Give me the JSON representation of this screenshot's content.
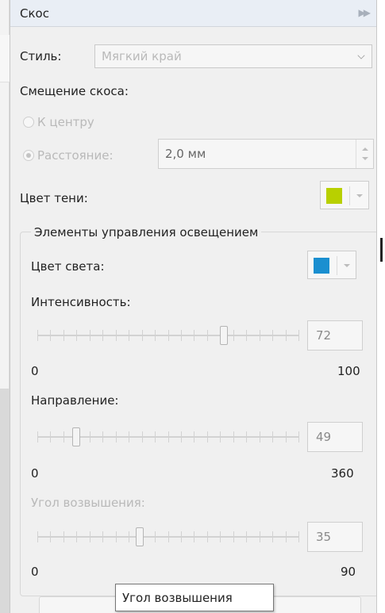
{
  "panel": {
    "title": "Скос",
    "style_label": "Стиль:",
    "style_value": "Мягкий край",
    "offset_heading": "Смещение скоса:",
    "radio_center_label": "К центру",
    "radio_distance_label": "Расстояние:",
    "distance_value": "2,0 мм",
    "shadow_color_label": "Цвет тени:",
    "shadow_color": "#b8d000"
  },
  "lighting": {
    "heading": "Элементы управления освещением",
    "light_color_label": "Цвет света:",
    "light_color": "#1a8fd0",
    "intensity": {
      "label": "Интенсивность:",
      "value": "72",
      "min": "0",
      "max": "100",
      "level": 72,
      "range": 100
    },
    "direction": {
      "label": "Направление:",
      "value": "49",
      "min": "0",
      "max": "360",
      "level": 49,
      "range": 360
    },
    "elevation": {
      "label": "Угол возвышения:",
      "value": "35",
      "min": "0",
      "max": "90",
      "level": 35,
      "range": 90
    }
  },
  "tooltip": {
    "text": "Угол возвышения"
  },
  "icons": {
    "collapse": "double-chevron-right-icon",
    "dropdown": "chevron-down-icon"
  }
}
